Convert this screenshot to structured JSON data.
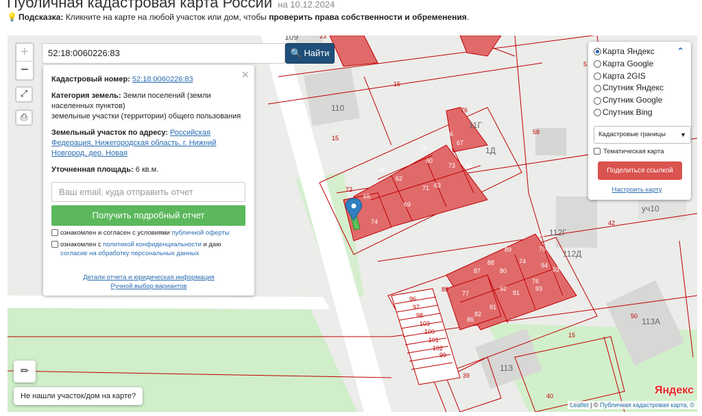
{
  "page": {
    "title": "Публичная кадастровая карта России",
    "date": "на 10.12.2024",
    "hint_label": "Подсказка:",
    "hint_text": "Кликните на карте на любой участок или дом, чтобы",
    "hint_bold": "проверить права собственности и обременения",
    "hint_end": "."
  },
  "colors": {
    "parcel_fill": "#e06a6a",
    "parcel_line": "#c00000",
    "accent": "#1f4e79",
    "report": "#5cb85c",
    "share": "#d9534f"
  },
  "search": {
    "value": "52:18:0060226:83",
    "button_label": "Найти",
    "icon": "search-icon"
  },
  "controls": {
    "zoom_in": "+",
    "zoom_out": "−",
    "fullscreen_icon": "expand-icon",
    "print_icon": "printer-icon"
  },
  "info": {
    "close": "×",
    "cad_label": "Кадастровый номер:",
    "cad_value": "52:18:0060226:83",
    "cat_label": "Категория земель:",
    "cat_value": "Земли поселений (земли населенных пунктов)",
    "cat_value2": "земельные участки (территории) общего пользования",
    "addr_label": "Земельный участок по адресу:",
    "addr_value": "Российская Федерация, Нижегородская область, г. Нижний Новгород, дер. Новая",
    "area_label": "Уточненная площадь:",
    "area_value": "6 кв.м.",
    "email_placeholder": "Ваш email, куда отправить отчет",
    "report_button": "Получить подробный отчет",
    "agree1_text": "ознакомлен и согласен с условиями",
    "agree1_link": "публичной оферты",
    "agree2_text": "ознакомлен с",
    "agree2_link": "политикой конфиденциальности",
    "agree2_mid": "и даю",
    "agree2_link2": "согласие на обработку персональных данных",
    "details_link": "Детали отчета и юридическая информация",
    "manual_link": "Ручной выбор вариантов"
  },
  "layers": {
    "options": [
      {
        "label": "Карта Яндекс",
        "selected": true
      },
      {
        "label": "Карта Google",
        "selected": false
      },
      {
        "label": "Карта 2GIS",
        "selected": false
      },
      {
        "label": "Спутник Яндекс",
        "selected": false
      },
      {
        "label": "Спутник Google",
        "selected": false
      },
      {
        "label": "Спутник Bing",
        "selected": false
      }
    ],
    "collapse_icon": "chevron-up-icon",
    "select_value": "Кадастровые границы",
    "thematic_label": "Тематическая карта",
    "share_button": "Поделиться ссылкой",
    "configure_link": "Настроить карту"
  },
  "map": {
    "building_labels": [
      "110",
      "11Г",
      "1Д",
      "112Г",
      "112Д",
      "113А",
      "113",
      "уч10",
      "109"
    ],
    "plot_numbers": [
      "15",
      "76",
      "58",
      "70",
      "67",
      "68",
      "60",
      "73",
      "64",
      "62",
      "72",
      "65",
      "71",
      "63",
      "69",
      "74",
      "42",
      "95",
      "89",
      "75",
      "88",
      "74",
      "94",
      "83",
      "87",
      "80",
      "76",
      "85",
      "77",
      "92",
      "81",
      "93",
      "86",
      "82",
      "91",
      "96",
      "97",
      "98",
      "103",
      "100",
      "101",
      "102",
      "99",
      "39",
      "50",
      "40",
      "23",
      "5"
    ],
    "not_found_button": "Не нашли участок/дом на карте?",
    "ruler_icon": "ruler-icon",
    "yandex_logo": "Яндекс",
    "attribution_leaflet": "Leaflet",
    "attribution_sep": "| ©",
    "attribution_text": "Публичная кадастровая карта, ©"
  }
}
